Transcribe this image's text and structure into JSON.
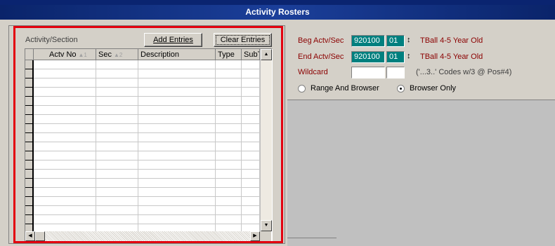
{
  "window": {
    "title": "Activity Rosters"
  },
  "left": {
    "section_label": "Activity/Section",
    "add_button": "Add Entries",
    "clear_button": "Clear Entries",
    "grid": {
      "columns": [
        {
          "label": "Actv No",
          "sort": "▲1"
        },
        {
          "label": "Sec",
          "sort": "▲2"
        },
        {
          "label": "Description",
          "sort": ""
        },
        {
          "label": "Type",
          "sort": ""
        },
        {
          "label": "SubT",
          "sort": "▲"
        }
      ],
      "rows": []
    }
  },
  "right": {
    "beg_label": "Beg Actv/Sec",
    "beg_actv": "920100",
    "beg_sec": "01",
    "beg_desc": "TBall 4-5 Year Old",
    "end_label": "End Actv/Sec",
    "end_actv": "920100",
    "end_sec": "01",
    "end_desc": "TBall 4-5 Year Old",
    "wildcard_label": "Wildcard",
    "wildcard_value1": "",
    "wildcard_value2": "",
    "wildcard_hint": "('...3..' Codes w/3 @ Pos#4)",
    "radio_range": "Range And Browser",
    "radio_browser": "Browser Only",
    "selected_radio": "browser"
  },
  "icons": {
    "updown": "up-down-arrow-icon",
    "scroll_up": "scroll-up-arrow-icon",
    "scroll_down": "scroll-down-arrow-icon",
    "scroll_left": "scroll-left-arrow-icon",
    "scroll_right": "scroll-right-arrow-icon"
  },
  "colors": {
    "title_bar": "#0a246a",
    "highlight": "#e3000f",
    "teal_field": "#00807f",
    "label": "#8b0000"
  }
}
